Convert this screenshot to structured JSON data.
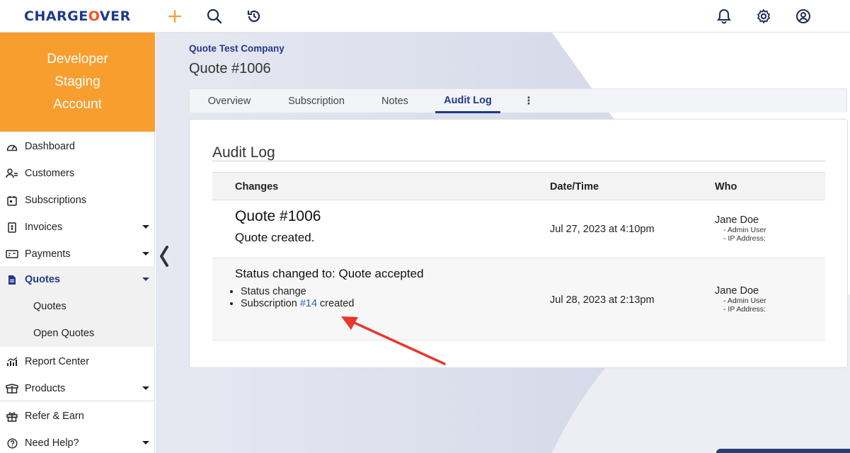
{
  "header": {
    "logo_text_1": "CHARGE",
    "logo_text_2": "O",
    "logo_text_3": "VER",
    "icons": [
      "plus-icon",
      "search-icon",
      "history-icon",
      "bell-icon",
      "gear-icon",
      "user-icon"
    ]
  },
  "sidebar": {
    "account": "Developer Staging Account",
    "items": [
      {
        "label": "Dashboard",
        "icon": "dashboard-icon"
      },
      {
        "label": "Customers",
        "icon": "users-icon"
      },
      {
        "label": "Subscriptions",
        "icon": "calendar-icon"
      },
      {
        "label": "Invoices",
        "icon": "invoice-icon"
      },
      {
        "label": "Payments",
        "icon": "payment-icon"
      },
      {
        "label": "Quotes",
        "icon": "document-icon"
      },
      {
        "label": "Quotes"
      },
      {
        "label": "Open Quotes"
      },
      {
        "label": "Report Center",
        "icon": "chart-icon"
      },
      {
        "label": "Products",
        "icon": "box-icon"
      },
      {
        "label": "Refer & Earn",
        "icon": "gift-icon"
      },
      {
        "label": "Need Help?",
        "icon": "help-icon"
      }
    ]
  },
  "page": {
    "company": "Quote Test Company",
    "title": "Quote #1006"
  },
  "tabs": [
    {
      "label": "Overview"
    },
    {
      "label": "Subscription"
    },
    {
      "label": "Notes"
    },
    {
      "label": "Audit Log",
      "active": true
    },
    {
      "label": "⋮"
    }
  ],
  "audit": {
    "title": "Audit Log",
    "columns": [
      "Changes",
      "Date/Time",
      "Who"
    ],
    "rows": [
      {
        "title": "Quote #1006",
        "subtitle": "Quote created.",
        "date": "Jul 27, 2023 at 4:10pm",
        "who": "Jane Doe",
        "meta1": "- Admin User",
        "meta2": "- IP Address:"
      },
      {
        "heading": "Status changed to: Quote accepted",
        "bullet1": "Status change",
        "bullet2_pre": "Subscription ",
        "bullet2_link": "#14",
        "bullet2_post": " created",
        "date": "Jul 28, 2023 at 2:13pm",
        "who": "Jane Doe",
        "meta1": "- Admin User",
        "meta2": "- IP Address:"
      }
    ]
  },
  "colors": {
    "brand_blue": "#1f3a8a",
    "brand_orange": "#f89e2f",
    "arrow_red": "#e8372c"
  }
}
